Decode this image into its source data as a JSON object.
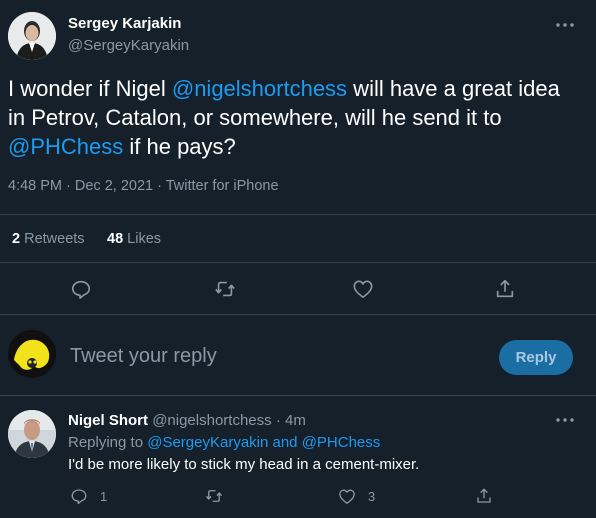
{
  "main_tweet": {
    "author_name": "Sergey Karjakin",
    "author_handle": "@SergeyKaryakin",
    "text_part1": "I wonder if Nigel ",
    "mention1": "@nigelshortchess",
    "text_part2": " will have a great idea in Petrov, Catalon, or somewhere, will he send it to ",
    "mention2": "@PHChess",
    "text_part3": " if he pays?",
    "timestamp": "4:48 PM · Dec 2, 2021 · Twitter for iPhone",
    "retweets_count": "2",
    "retweets_label": " Retweets",
    "likes_count": "48",
    "likes_label": " Likes"
  },
  "reply_composer": {
    "placeholder": "Tweet your reply",
    "button_label": "Reply"
  },
  "reply_tweet": {
    "author_name": "Nigel Short",
    "author_handle": "@nigelshortchess",
    "time_ago": "· 4m",
    "replying_prefix": "Replying to ",
    "replying_to": "@SergeyKaryakin and @PHChess",
    "text": "I'd be more likely to stick my head in a cement-mixer.",
    "reply_count": "1",
    "like_count": "3"
  },
  "colors": {
    "background": "#15202b",
    "accent": "#1d9bf0",
    "muted": "#8b98a5",
    "divider": "#38444d",
    "reply_button": "#1a6ea4"
  },
  "icons": [
    "more-icon",
    "reply-icon",
    "retweet-icon",
    "like-icon",
    "share-icon"
  ]
}
